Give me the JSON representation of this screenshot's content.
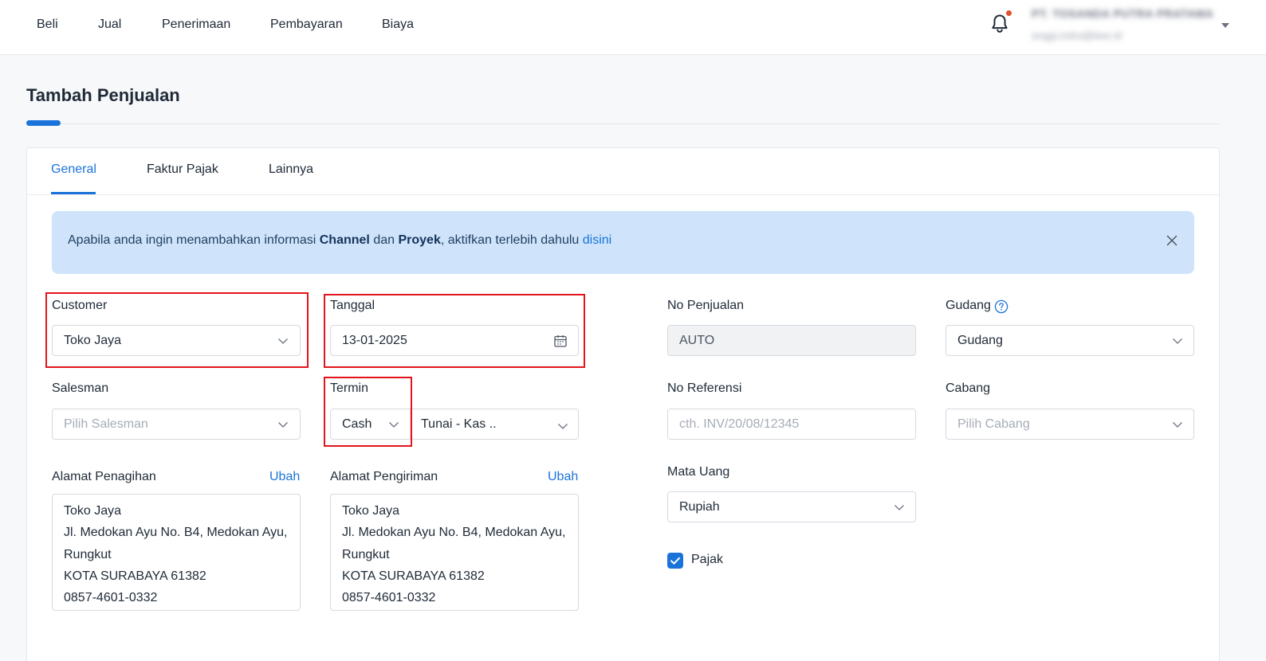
{
  "nav": {
    "items": [
      "Beli",
      "Jual",
      "Penerimaan",
      "Pembayaran",
      "Biaya"
    ]
  },
  "account": {
    "company": "PT. TOSANDA PUTRA PRATAMA",
    "email": "anggi.indra@bee.id"
  },
  "page": {
    "title": "Tambah Penjualan"
  },
  "tabs": [
    "General",
    "Faktur Pajak",
    "Lainnya"
  ],
  "banner": {
    "text_1": "Apabila anda ingin menambahkan informasi ",
    "bold_1": "Channel",
    "text_2": " dan ",
    "bold_2": "Proyek",
    "text_3": ", aktifkan terlebih dahulu ",
    "link": "disini"
  },
  "form": {
    "customer": {
      "label": "Customer",
      "value": "Toko Jaya"
    },
    "tanggal": {
      "label": "Tanggal",
      "value": "13-01-2025"
    },
    "no_penjualan": {
      "label": "No Penjualan",
      "value": "AUTO"
    },
    "gudang": {
      "label": "Gudang",
      "value": "Gudang"
    },
    "salesman": {
      "label": "Salesman",
      "placeholder": "Pilih Salesman"
    },
    "termin": {
      "label": "Termin",
      "value": "Cash",
      "account": "Tunai - Kas .."
    },
    "no_referensi": {
      "label": "No Referensi",
      "placeholder": "cth. INV/20/08/12345"
    },
    "cabang": {
      "label": "Cabang",
      "placeholder": "Pilih Cabang"
    },
    "alamat_penagihan": {
      "label": "Alamat Penagihan",
      "action": "Ubah",
      "lines": [
        "Toko Jaya",
        "Jl. Medokan Ayu No. B4, Medokan Ayu,",
        "Rungkut",
        "KOTA SURABAYA 61382",
        "0857-4601-0332"
      ]
    },
    "alamat_pengiriman": {
      "label": "Alamat Pengiriman",
      "action": "Ubah",
      "lines": [
        "Toko Jaya",
        "Jl. Medokan Ayu No. B4, Medokan Ayu,",
        "Rungkut",
        "KOTA SURABAYA 61382",
        "0857-4601-0332"
      ]
    },
    "mata_uang": {
      "label": "Mata Uang",
      "value": "Rupiah"
    },
    "pajak": {
      "label": "Pajak",
      "checked": true
    }
  },
  "colors": {
    "accent": "#1a73d9",
    "banner_bg": "#cfe4fb",
    "highlight": "#e3141b",
    "notification": "#e2532d"
  },
  "icons": [
    "bell-icon",
    "chevron-down-icon",
    "calendar-icon",
    "close-icon",
    "help-circle-icon",
    "check-icon"
  ]
}
